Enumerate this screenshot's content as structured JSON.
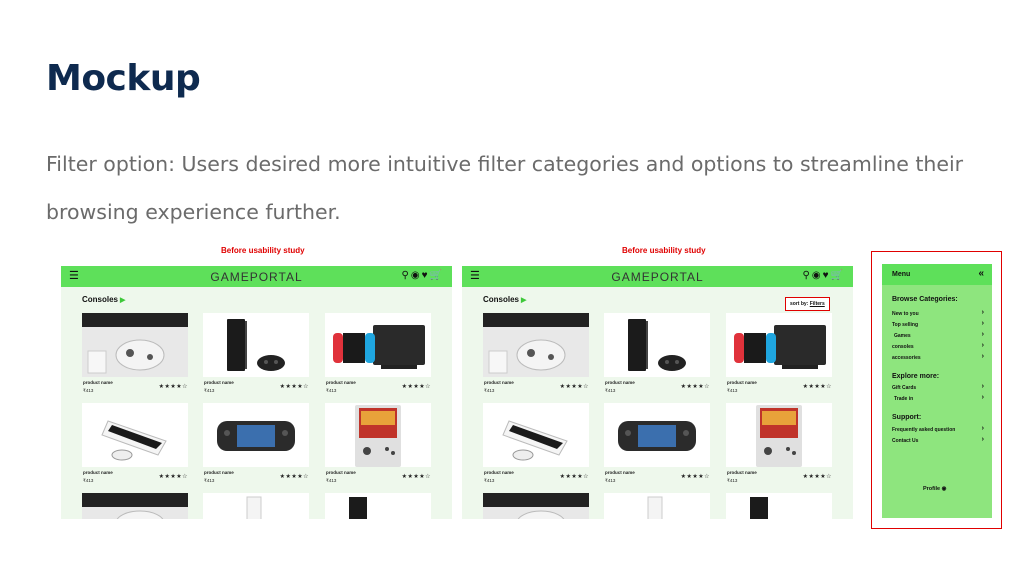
{
  "page": {
    "title": "Mockup",
    "description": "Filter option: Users desired more intuitive filter categories and options to streamline their browsing experience further."
  },
  "mock_before": {
    "label": "Before usability study",
    "logo": "GAMEPORTAL",
    "category": "Consoles",
    "products": [
      {
        "name": "product name",
        "price": "₹413",
        "rating": "★★★★☆",
        "image": "xbox-console"
      },
      {
        "name": "product name",
        "price": "₹413",
        "rating": "★★★★☆",
        "image": "ps4-console"
      },
      {
        "name": "product name",
        "price": "₹413",
        "rating": "★★★★☆",
        "image": "switch-console"
      },
      {
        "name": "product name",
        "price": "₹413",
        "rating": "★★★★☆",
        "image": "ps5-console"
      },
      {
        "name": "product name",
        "price": "₹413",
        "rating": "★★★★☆",
        "image": "steam-deck"
      },
      {
        "name": "product name",
        "price": "₹413",
        "rating": "★★★★☆",
        "image": "handheld-retro"
      }
    ]
  },
  "mock_after": {
    "label": "Before usability study",
    "logo": "GAMEPORTAL",
    "category": "Consoles",
    "sort_prefix": "sort by: ",
    "sort_link": "Filters",
    "products": [
      {
        "name": "product name",
        "price": "₹413",
        "rating": "★★★★☆",
        "image": "xbox-console"
      },
      {
        "name": "product name",
        "price": "₹413",
        "rating": "★★★★☆",
        "image": "ps4-console"
      },
      {
        "name": "product name",
        "price": "₹413",
        "rating": "★★★★☆",
        "image": "switch-console"
      },
      {
        "name": "product name",
        "price": "₹413",
        "rating": "★★★★☆",
        "image": "ps5-console"
      },
      {
        "name": "product name",
        "price": "₹413",
        "rating": "★★★★☆",
        "image": "steam-deck"
      },
      {
        "name": "product name",
        "price": "₹413",
        "rating": "★★★★☆",
        "image": "handheld-retro"
      }
    ]
  },
  "menu": {
    "title": "Menu",
    "close_icon": "«",
    "browse_title": "Browse Categories:",
    "browse_items": [
      "New to you",
      "Top selling",
      "Games",
      "consoles",
      "accessories"
    ],
    "explore_title": "Explore more:",
    "explore_items": [
      "Gift Cards",
      "Trade in"
    ],
    "support_title": "Support:",
    "support_items": [
      "Frequently asked question",
      "Contact Us"
    ],
    "profile": "Profile"
  },
  "colors": {
    "header": "#5ee05a",
    "menu_bg": "#8ee57e",
    "highlight": "#e00000",
    "title": "#0e2a4f"
  }
}
